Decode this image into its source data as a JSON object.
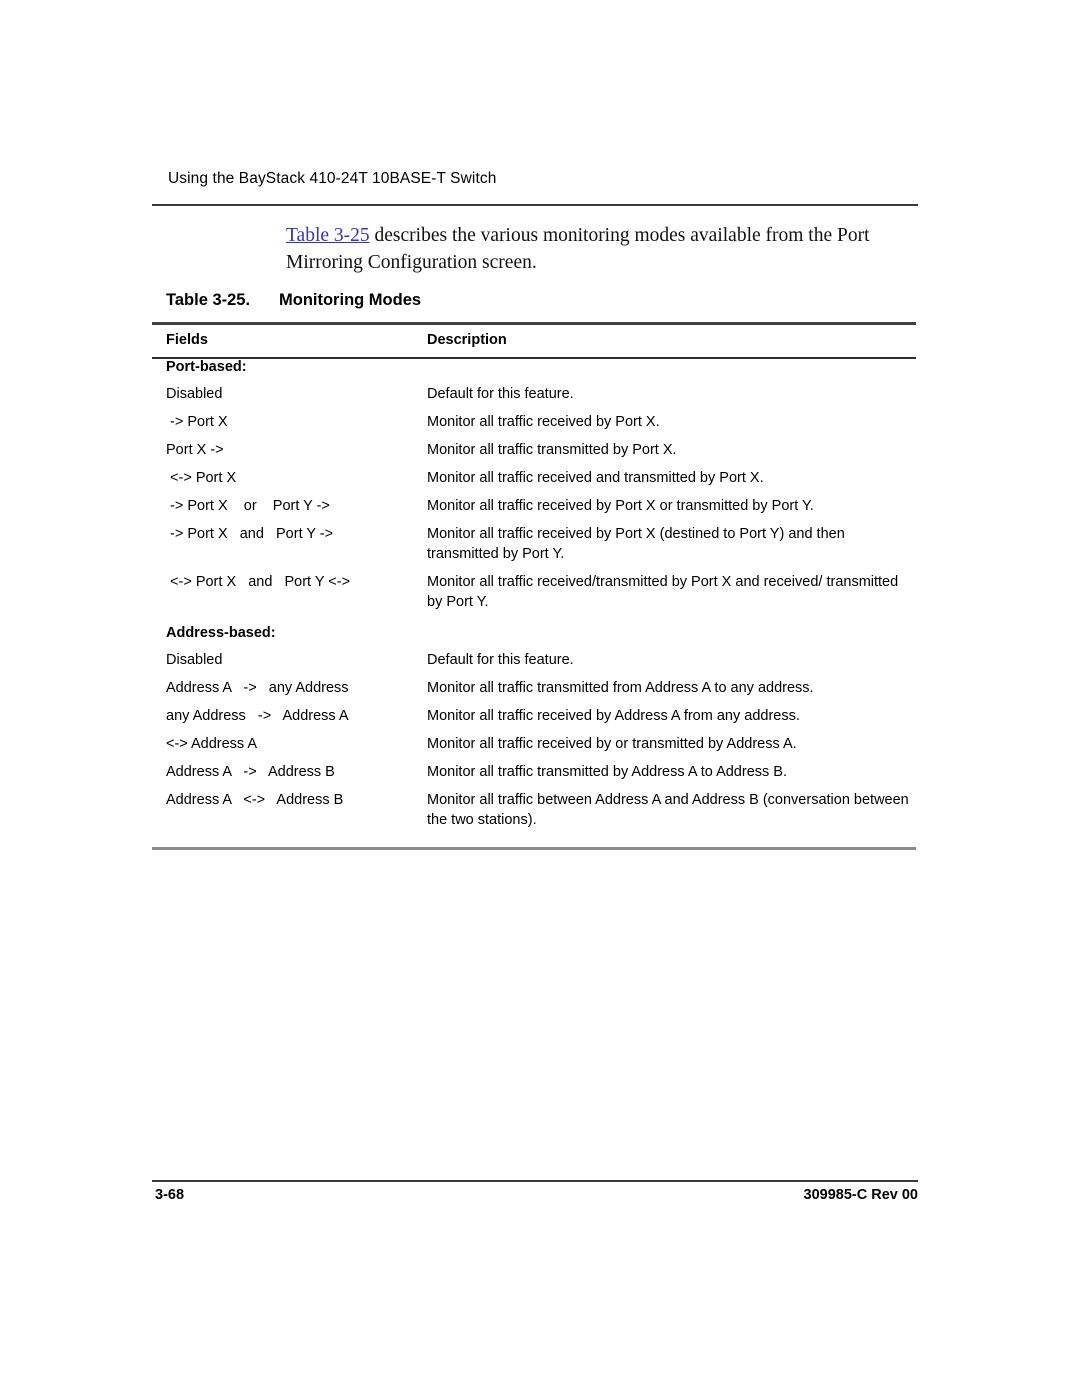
{
  "running_header": "Using the BayStack 410-24T 10BASE-T Switch",
  "intro": {
    "xref": "Table 3-25",
    "rest": " describes the various monitoring modes available from the Port Mirroring Configuration screen."
  },
  "table": {
    "caption_label": "Table 3-25.",
    "caption_title": "Monitoring Modes",
    "columns": [
      "Fields",
      "Description"
    ],
    "groups": [
      {
        "heading": "Port-based:",
        "rows": [
          {
            "field": "Disabled",
            "description": "Default for this feature."
          },
          {
            "field": " -> Port X",
            "description": "Monitor all traffic received by Port X."
          },
          {
            "field": "Port X ->",
            "description": "Monitor all traffic transmitted by Port X."
          },
          {
            "field": " <-> Port X",
            "description": "Monitor all traffic received and transmitted by Port X."
          },
          {
            "field": " -> Port X    or    Port Y ->",
            "description": "Monitor all traffic received by Port X or transmitted by Port Y."
          },
          {
            "field": " -> Port X   and   Port Y ->",
            "description": "Monitor all traffic received by Port X (destined to Port Y) and then transmitted by Port Y."
          },
          {
            "field": " <-> Port X   and   Port Y <->",
            "description": "Monitor all traffic received/transmitted by Port X and received/ transmitted by Port Y."
          }
        ]
      },
      {
        "heading": "Address-based:",
        "rows": [
          {
            "field": "Disabled",
            "description": "Default for this feature."
          },
          {
            "field": "Address A   ->   any Address",
            "description": "Monitor all traffic transmitted from Address A to any address."
          },
          {
            "field": "any Address   ->   Address A",
            "description": "Monitor all traffic received by Address A from any address."
          },
          {
            "field": "<-> Address A",
            "description": "Monitor all traffic received by or transmitted by Address A."
          },
          {
            "field": "Address A   ->   Address B",
            "description": "Monitor all traffic transmitted by Address A to Address B."
          },
          {
            "field": "Address A   <->   Address B",
            "description": "Monitor all traffic between Address A and Address B (conversation between the two stations)."
          }
        ]
      }
    ]
  },
  "footer": {
    "page_number": "3-68",
    "document_id": "309985-C Rev 00"
  }
}
